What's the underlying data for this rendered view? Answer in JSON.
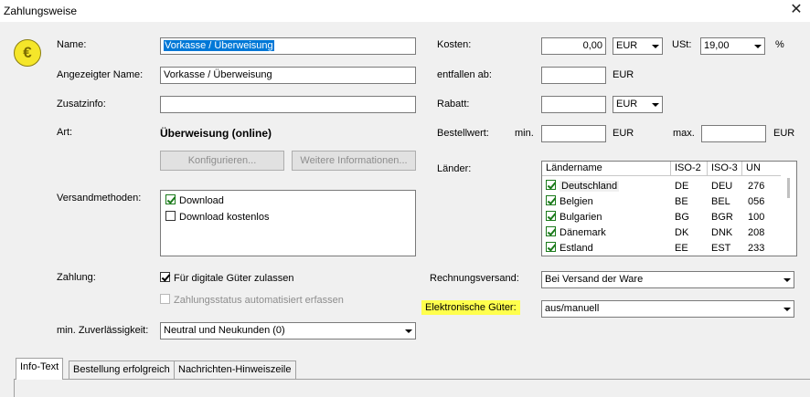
{
  "window": {
    "title": "Zahlungsweise",
    "close_glyph": "✕"
  },
  "icon": {
    "name": "euro-icon",
    "glyph": "€",
    "color": "#f5e62a"
  },
  "left": {
    "name_label": "Name:",
    "name_value": "Vorkasse / Überweisung",
    "display_name_label": "Angezeigter Name:",
    "display_name_value": "Vorkasse / Überweisung",
    "extra_info_label": "Zusatzinfo:",
    "extra_info_value": "",
    "type_label": "Art:",
    "type_value": "Überweisung (online)",
    "configure_button": "Konfigurieren...",
    "more_info_button": "Weitere Informationen...",
    "shipping_label": "Versandmethoden:",
    "shipping_methods": [
      {
        "label": "Download",
        "checked": true
      },
      {
        "label": "Download kostenlos",
        "checked": false
      }
    ],
    "payment_label": "Zahlung:",
    "digital_goods_label": "Für digitale Güter zulassen",
    "digital_goods_checked": true,
    "auto_status_label": "Zahlungsstatus automatisiert erfassen",
    "auto_status_checked": false,
    "reliability_label": "min. Zuverlässigkeit:",
    "reliability_value": "Neutral und Neukunden (0)"
  },
  "right": {
    "cost_label": "Kosten:",
    "cost_value": "0,00",
    "cost_currency": "EUR",
    "vat_label": "USt:",
    "vat_value": "19,00",
    "vat_unit": "%",
    "waived_label": "entfallen ab:",
    "waived_value": "",
    "waived_currency": "EUR",
    "discount_label": "Rabatt:",
    "discount_value": "",
    "discount_currency": "EUR",
    "order_value_label": "Bestellwert:",
    "min_label": "min.",
    "min_value": "",
    "min_currency": "EUR",
    "max_label": "max.",
    "max_value": "",
    "max_currency": "EUR",
    "countries_label": "Länder:",
    "countries_columns": [
      "Ländername",
      "ISO-2",
      "ISO-3",
      "UN"
    ],
    "countries": [
      {
        "name": "Deutschland",
        "iso2": "DE",
        "iso3": "DEU",
        "un": "276",
        "checked": true
      },
      {
        "name": "Belgien",
        "iso2": "BE",
        "iso3": "BEL",
        "un": "056",
        "checked": true
      },
      {
        "name": "Bulgarien",
        "iso2": "BG",
        "iso3": "BGR",
        "un": "100",
        "checked": true
      },
      {
        "name": "Dänemark",
        "iso2": "DK",
        "iso3": "DNK",
        "un": "208",
        "checked": true
      },
      {
        "name": "Estland",
        "iso2": "EE",
        "iso3": "EST",
        "un": "233",
        "checked": true
      }
    ],
    "invoice_label": "Rechnungsversand:",
    "invoice_value": "Bei Versand der Ware",
    "electronic_goods_label": "Elektronische Güter:",
    "electronic_goods_value": "aus/manuell",
    "highlight_color": "#ffff4d"
  },
  "tabs": [
    {
      "label": "Info-Text",
      "active": true
    },
    {
      "label": "Bestellung erfolgreich",
      "active": false
    },
    {
      "label": "Nachrichten-Hinweiszeile",
      "active": false
    }
  ]
}
